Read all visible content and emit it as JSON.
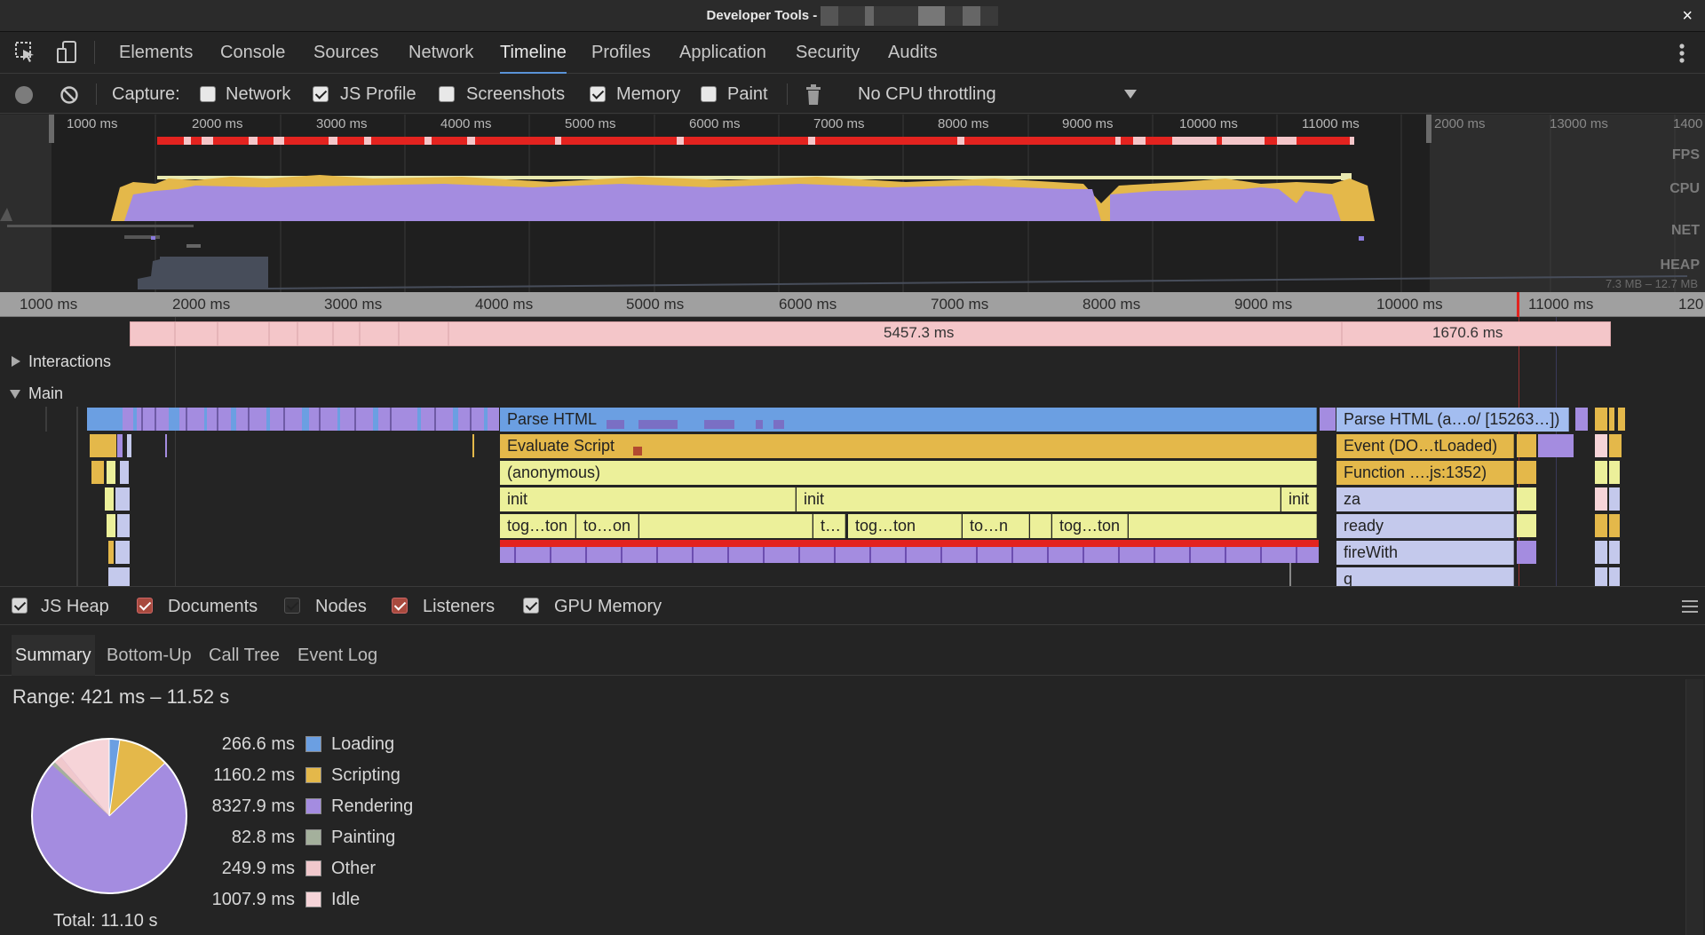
{
  "window": {
    "title": "Developer Tools -",
    "close": "×"
  },
  "tabs": [
    "Elements",
    "Console",
    "Sources",
    "Network",
    "Timeline",
    "Profiles",
    "Application",
    "Security",
    "Audits"
  ],
  "active_tab": "Timeline",
  "toolbar": {
    "capture_label": "Capture:",
    "checkboxes": [
      {
        "label": "Network",
        "checked": false
      },
      {
        "label": "JS Profile",
        "checked": true
      },
      {
        "label": "Screenshots",
        "checked": false
      },
      {
        "label": "Memory",
        "checked": true
      },
      {
        "label": "Paint",
        "checked": false
      }
    ],
    "throttling": "No CPU throttling"
  },
  "overview": {
    "ticks": [
      "1000 ms",
      "2000 ms",
      "3000 ms",
      "4000 ms",
      "5000 ms",
      "6000 ms",
      "7000 ms",
      "8000 ms",
      "9000 ms",
      "10000 ms",
      "11000 ms",
      "2000 ms",
      "13000 ms",
      "1400"
    ],
    "labels": [
      "FPS",
      "CPU",
      "NET",
      "HEAP"
    ],
    "heap_range": "7.3 MB – 12.7 MB"
  },
  "ruler": {
    "ticks": [
      "1000 ms",
      "2000 ms",
      "3000 ms",
      "4000 ms",
      "5000 ms",
      "6000 ms",
      "7000 ms",
      "8000 ms",
      "9000 ms",
      "10000 ms",
      "11000 ms",
      "120"
    ]
  },
  "frames": {
    "a": "5457.3 ms",
    "b": "1670.6 ms"
  },
  "sections": {
    "interactions": "Interactions",
    "main": "Main"
  },
  "flame": {
    "parse_html": "Parse HTML",
    "evaluate_script": "Evaluate Script",
    "anonymous": "(anonymous)",
    "init1": "init",
    "init2": "init",
    "init3": "init",
    "tog1": "tog…ton",
    "to1": "to…on",
    "t1": "t…",
    "tog2": "tog…ton",
    "to2": "to…n",
    "tog3": "tog…ton",
    "parse_html2": "Parse HTML (a…o/ [15263…])",
    "event": "Event (DO…tLoaded)",
    "function": "Function ….js:1352)",
    "za": "za",
    "ready": "ready",
    "firewith": "fireWith",
    "q": "q"
  },
  "memory": [
    {
      "label": "JS Heap",
      "style": "gray"
    },
    {
      "label": "Documents",
      "style": "red"
    },
    {
      "label": "Nodes",
      "style": "dark"
    },
    {
      "label": "Listeners",
      "style": "red"
    },
    {
      "label": "GPU Memory",
      "style": "gray"
    }
  ],
  "summary_tabs": [
    "Summary",
    "Bottom-Up",
    "Call Tree",
    "Event Log"
  ],
  "active_summary_tab": "Summary",
  "range": "Range: 421 ms – 11.52 s",
  "legend": [
    {
      "value": "266.6 ms",
      "label": "Loading",
      "color": "#6b9fe2"
    },
    {
      "value": "1160.2 ms",
      "label": "Scripting",
      "color": "#e4b84a"
    },
    {
      "value": "8327.9 ms",
      "label": "Rendering",
      "color": "#a48ce0"
    },
    {
      "value": "82.8 ms",
      "label": "Painting",
      "color": "#a4b09c"
    },
    {
      "value": "249.9 ms",
      "label": "Other",
      "color": "#f0c8cc"
    },
    {
      "value": "1007.9 ms",
      "label": "Idle",
      "color": "#f6d4d8"
    }
  ],
  "total": "Total: 11.10 s"
}
